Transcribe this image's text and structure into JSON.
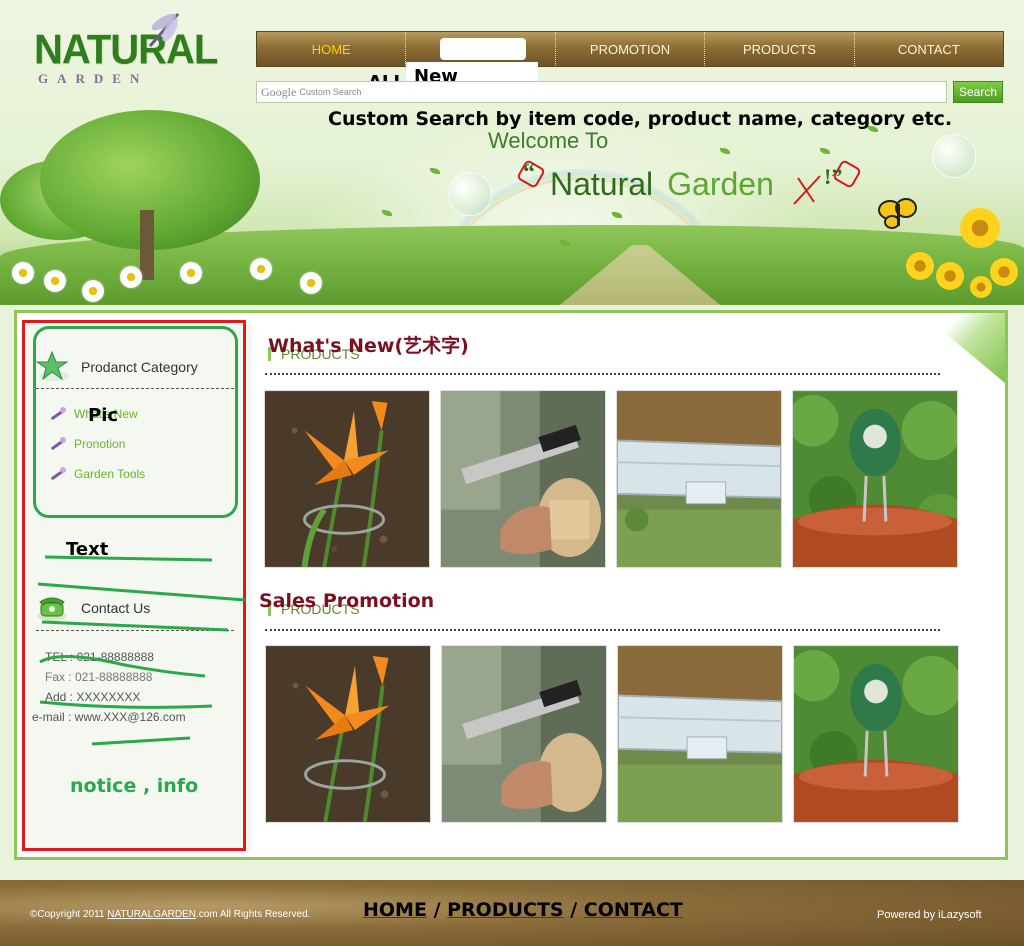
{
  "logo": {
    "main": "NATURAL",
    "sub": "GARDEN"
  },
  "nav": {
    "items": [
      {
        "label": "HOME",
        "active": true
      },
      {
        "label": "",
        "active": false
      },
      {
        "label": "PROMOTION",
        "active": false
      },
      {
        "label": "PRODUCTS",
        "active": false
      },
      {
        "label": "CONTACT",
        "active": false
      }
    ]
  },
  "annotations": {
    "all": "ALL",
    "new": "New",
    "search_note": "Custom Search by item code, product name, category etc.",
    "pic": "Pic",
    "text": "Text",
    "notice": "notice , info",
    "whats_new": "What's New(艺术字)",
    "sales_promotion": "Sales Promotion"
  },
  "search": {
    "google": "Google",
    "placeholder": "Custom Search",
    "button": "Search"
  },
  "banner": {
    "welcome": "Welcome To",
    "title_a": "Natural",
    "title_b": "Garden",
    "open_quote": "“",
    "close_quote": "!”"
  },
  "sidebar": {
    "category_heading": "Prodanct Category",
    "categories": [
      {
        "label": "What's New"
      },
      {
        "label": "Pronotion"
      },
      {
        "label": "Garden Tools"
      }
    ],
    "contact_heading": "Contact Us",
    "contact": {
      "tel": "TEL : 021-88888888",
      "fax": "Fax : 021-88888888",
      "add": "Add : XXXXXXXX",
      "email": "e-mail : www.XXX@126.com"
    }
  },
  "sections": {
    "new_products_label": "PRODUCTS",
    "promo_products_label": "PRODUCTS",
    "items": [
      "lily",
      "tool",
      "greenhouse",
      "meter"
    ]
  },
  "footer": {
    "copyright_pre": "©Copyright 2011 ",
    "copyright_site": "NATURALGARDEN",
    "copyright_post": ".com All Rights Reserved.",
    "nav": [
      "HOME",
      "PRODUCTS",
      "CONTACT"
    ],
    "sep": " / ",
    "powered": "Powered by iLazysoft"
  },
  "colors": {
    "accent_green": "#8cc55a",
    "title_red": "#7b1020",
    "annotation_red": "#e01a1a",
    "annotation_green": "#2aa84a",
    "nav_active": "#ffd200"
  }
}
